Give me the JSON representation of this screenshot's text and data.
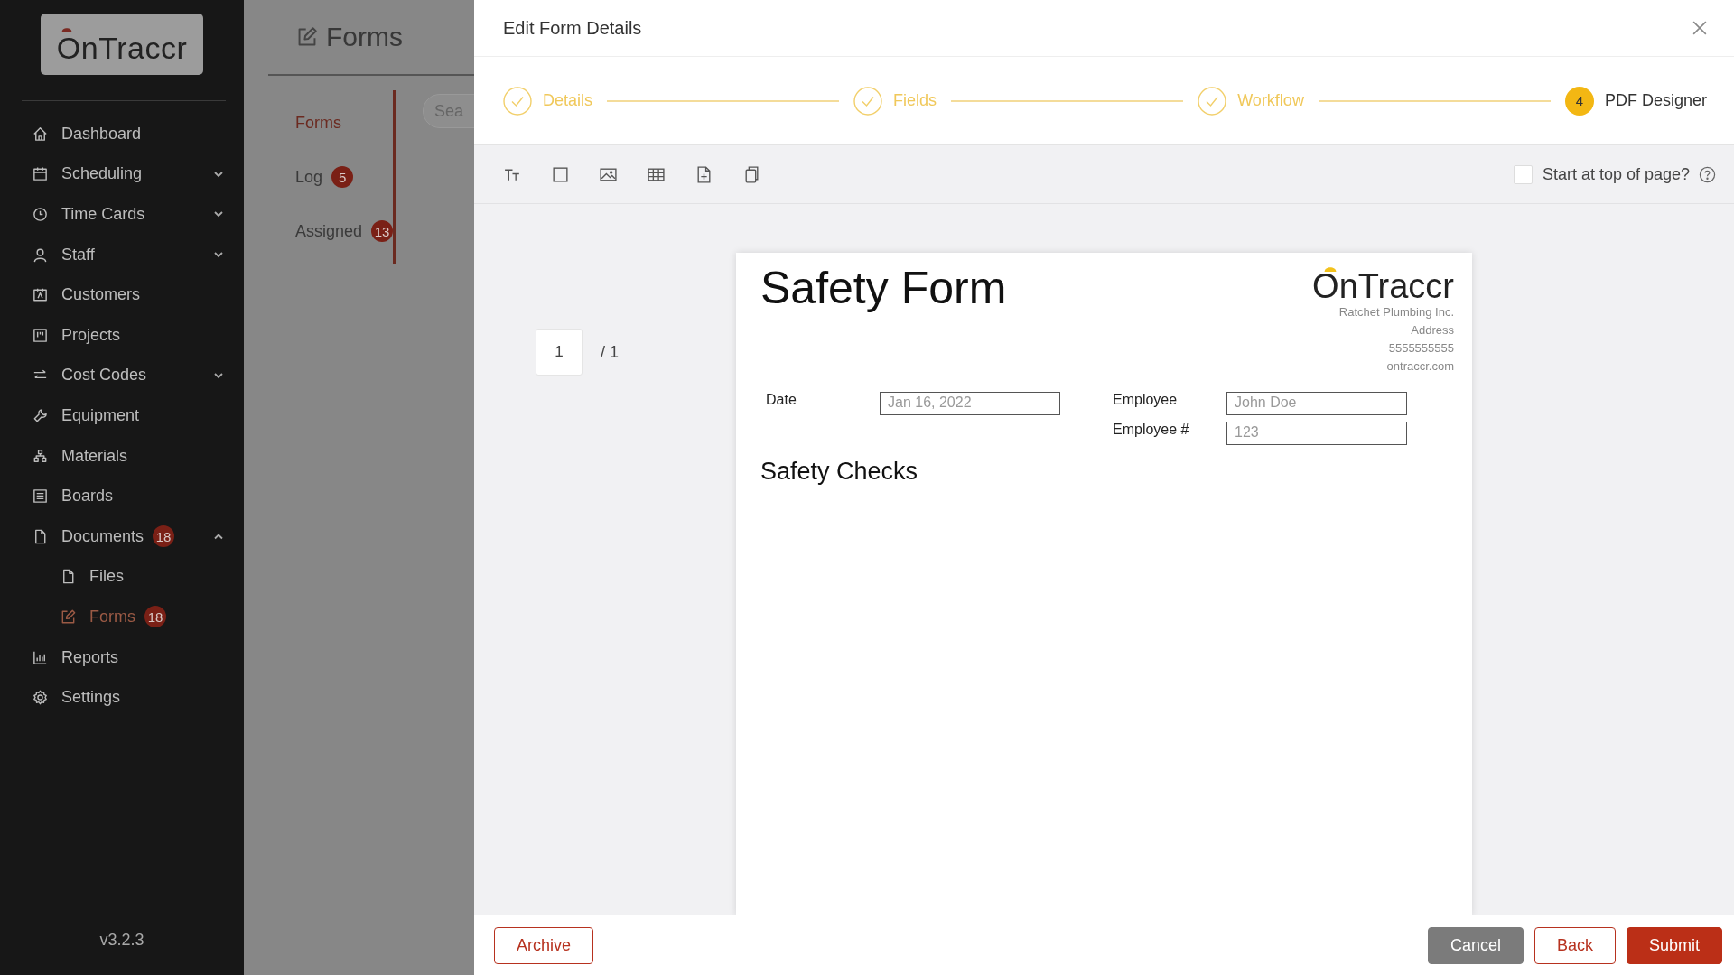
{
  "sidebar": {
    "logo": "OnTraccr",
    "version": "v3.2.3",
    "items": [
      {
        "label": "Dashboard",
        "selected": false
      },
      {
        "label": "Scheduling",
        "selected": false,
        "expanded": false
      },
      {
        "label": "Time Cards",
        "selected": false,
        "expanded": false
      },
      {
        "label": "Staff",
        "selected": false,
        "expanded": false
      },
      {
        "label": "Customers",
        "selected": false
      },
      {
        "label": "Projects",
        "selected": false
      },
      {
        "label": "Cost Codes",
        "selected": false,
        "expanded": false
      },
      {
        "label": "Equipment",
        "selected": false
      },
      {
        "label": "Materials",
        "selected": false
      },
      {
        "label": "Boards",
        "selected": false
      },
      {
        "label": "Documents",
        "selected": false,
        "badge": "18",
        "expanded": true,
        "children": [
          {
            "label": "Files",
            "selected": false
          },
          {
            "label": "Forms",
            "selected": true,
            "badge": "18"
          }
        ]
      },
      {
        "label": "Reports",
        "selected": false
      },
      {
        "label": "Settings",
        "selected": false
      }
    ]
  },
  "page": {
    "title": "Forms",
    "search": {
      "placeholder": "Sea"
    },
    "tabs": [
      {
        "label": "Forms",
        "selected": true
      },
      {
        "label": "Log",
        "selected": false,
        "badge": "5"
      },
      {
        "label": "Assigned",
        "selected": false,
        "badge": "13"
      }
    ]
  },
  "dialog": {
    "title": "Edit Form Details",
    "steps": [
      {
        "label": "Details",
        "completed": true
      },
      {
        "label": "Fields",
        "completed": true
      },
      {
        "label": "Workflow",
        "completed": true
      },
      {
        "label": "PDF Designer",
        "completed": false,
        "number": "4"
      }
    ],
    "start_at_top": {
      "label": "Start at top of page?",
      "checked": false
    },
    "pager": {
      "page": "1",
      "total": "/ 1"
    },
    "document": {
      "title": "Safety Form",
      "logo": "OnTraccr",
      "company_lines": [
        "Ratchet Plumbing Inc.",
        "Address",
        "5555555555",
        "ontraccr.com"
      ],
      "left_fields": [
        {
          "label": "Date",
          "value": "Jan 16, 2022"
        }
      ],
      "right_fields": [
        {
          "label": "Employee",
          "value": "John Doe"
        },
        {
          "label": "Employee #",
          "value": "123"
        }
      ],
      "section": "Safety Checks"
    },
    "footer": {
      "left": [
        {
          "label": "Archive",
          "kind": "outline"
        }
      ],
      "right": [
        {
          "label": "Cancel",
          "kind": "muted"
        },
        {
          "label": "Back",
          "kind": "outline"
        },
        {
          "label": "Submit",
          "kind": "primary"
        }
      ]
    }
  }
}
